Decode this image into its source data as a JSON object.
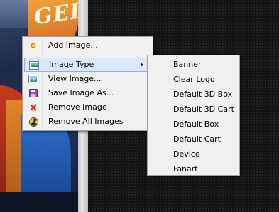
{
  "context_menu": {
    "items": [
      {
        "label": "Add Image...",
        "icon": "add-image-icon"
      },
      {
        "label": "Image Type",
        "icon": "image-type-icon",
        "has_submenu": true,
        "highlighted": true
      },
      {
        "label": "View Image...",
        "icon": "view-image-icon"
      },
      {
        "label": "Save Image As...",
        "icon": "save-icon"
      },
      {
        "label": "Remove Image",
        "icon": "remove-icon"
      },
      {
        "label": "Remove All Images",
        "icon": "radioactive-icon"
      }
    ]
  },
  "image_type_submenu": {
    "items": [
      "Banner",
      "Clear Logo",
      "Default 3D Box",
      "Default 3D Cart",
      "Default Box",
      "Default Cart",
      "Device",
      "Fanart"
    ]
  },
  "colors": {
    "menu_bg": "#f0f0f0",
    "highlight_bg": "#dbe8f7",
    "highlight_border": "#8fb3e0",
    "remove_icon": "#e02020"
  }
}
